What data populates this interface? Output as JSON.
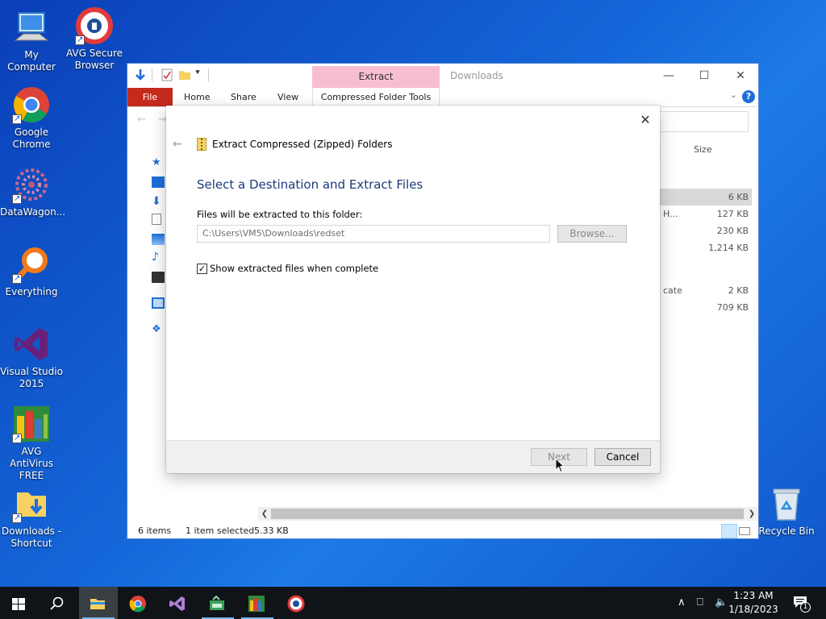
{
  "desktop": {
    "icons": [
      {
        "label": "My Computer"
      },
      {
        "label": "AVG Secure Browser"
      },
      {
        "label": "Google Chrome"
      },
      {
        "label": "DataWagon..."
      },
      {
        "label": "Everything"
      },
      {
        "label": "Visual Studio 2015"
      },
      {
        "label": "AVG AntiVirus FREE"
      },
      {
        "label": "Downloads - Shortcut"
      },
      {
        "label": "Recycle Bin"
      }
    ]
  },
  "explorer": {
    "title": "Downloads",
    "context_tab": "Extract",
    "ribbon_tabs": {
      "file": "File",
      "home": "Home",
      "share": "Share",
      "view": "View",
      "compressed": "Compressed Folder Tools"
    },
    "column_header": "Size",
    "rows": [
      {
        "extra": "",
        "size": "6 KB"
      },
      {
        "extra": "H...",
        "size": "127 KB"
      },
      {
        "extra": "",
        "size": "230 KB"
      },
      {
        "extra": "",
        "size": "1,214 KB"
      },
      {
        "extra": "cate",
        "size": "2 KB"
      },
      {
        "extra": "",
        "size": "709 KB"
      }
    ],
    "status": {
      "items": "6 items",
      "selected": "1 item selected",
      "size": "5.33 KB"
    }
  },
  "dialog": {
    "caption": "Extract Compressed (Zipped) Folders",
    "heading": "Select a Destination and Extract Files",
    "path_label": "Files will be extracted to this folder:",
    "path_value": "C:\\Users\\VM5\\Downloads\\redset",
    "browse_label": "Browse...",
    "checkbox_label": "Show extracted files when complete",
    "checkbox_checked": true,
    "next_label": "Next",
    "cancel_label": "Cancel"
  },
  "taskbar": {
    "time": "1:23 AM",
    "date": "1/18/2023",
    "notification_count": "1"
  }
}
